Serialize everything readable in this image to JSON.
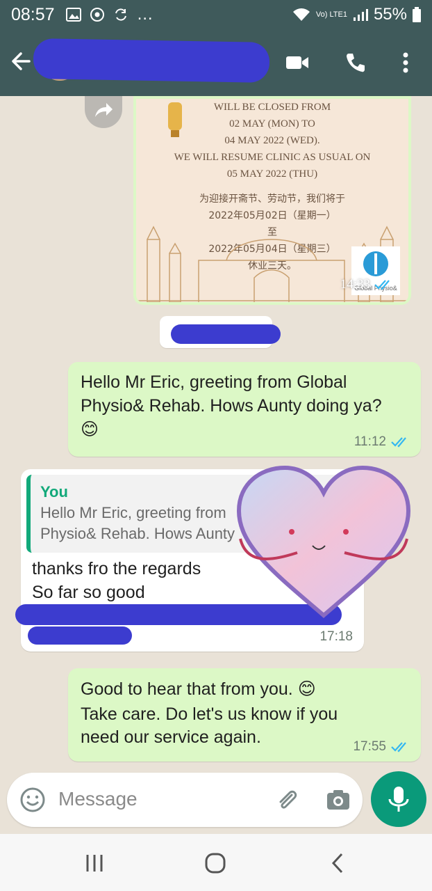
{
  "status_bar": {
    "time": "08:57",
    "more": "…",
    "volte": "Vo) LTE1",
    "battery": "55%"
  },
  "app_bar": {
    "contact_name": ""
  },
  "messages": {
    "announcement": {
      "lines": [
        "WILL BE CLOSED FROM",
        "02 MAY (MON) TO",
        "04 MAY 2022 (WED).",
        "WE WILL RESUME CLINIC AS USUAL ON",
        "05 MAY 2022 (THU)"
      ],
      "cn_lines": [
        "为迎接开斋节、劳动节，我们将于",
        "2022年05月02日（星期一）",
        "至",
        "2022年05月04日（星期三）",
        "休业三天。"
      ],
      "logo_text": "Global Physio&",
      "time": "14:33"
    },
    "msg1": {
      "text": "Hello Mr Eric, greeting from Global Physio& Rehab. Hows Aunty doing ya?",
      "emoji": "😊",
      "time": "11:12"
    },
    "msg2": {
      "quote_author": "You",
      "quote_line1": "Hello Mr Eric, greeting from",
      "quote_line2": "Physio& Rehab. Hows Aunty",
      "line1": "thanks fro the regards",
      "line2": "So far so good",
      "time": "17:18"
    },
    "msg3": {
      "line1": "Good to hear that from you.",
      "emoji": "😊",
      "line2": "Take care. Do let's  us know if you",
      "line3": "need our service again.",
      "time": "17:55"
    }
  },
  "input": {
    "placeholder": "Message"
  },
  "colors": {
    "header": "#3f5a5b",
    "outgoing_bubble": "#dcf8c6",
    "incoming_bubble": "#ffffff",
    "accent": "#0a9a7a",
    "read_ticks": "#34b7f1"
  }
}
